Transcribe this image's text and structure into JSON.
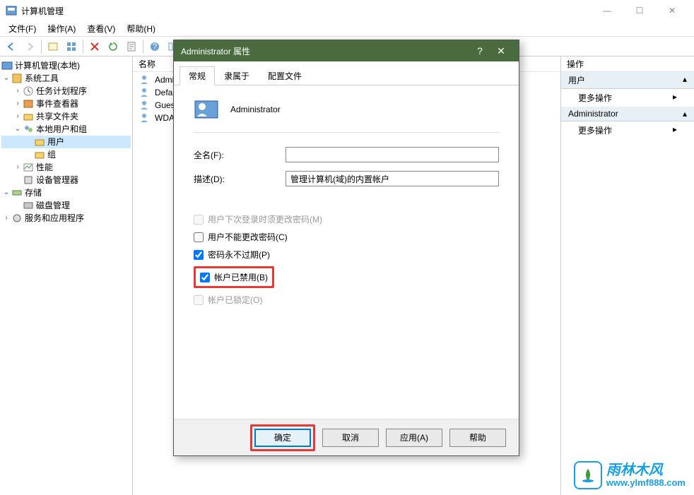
{
  "window": {
    "title": "计算机管理"
  },
  "menu": {
    "file": "文件(F)",
    "action": "操作(A)",
    "view": "查看(V)",
    "help": "帮助(H)"
  },
  "tree": {
    "root": "计算机管理(本地)",
    "system_tools": "系统工具",
    "task_scheduler": "任务计划程序",
    "event_viewer": "事件查看器",
    "shared_folders": "共享文件夹",
    "local_users": "本地用户和组",
    "users": "用户",
    "groups": "组",
    "performance": "性能",
    "device_manager": "设备管理器",
    "storage": "存储",
    "disk_mgmt": "磁盘管理",
    "services": "服务和应用程序"
  },
  "list": {
    "header": "名称",
    "items": [
      "Admi...",
      "Defa...",
      "Gues...",
      "WDA..."
    ]
  },
  "actions": {
    "header": "操作",
    "section1": "用户",
    "more1": "更多操作",
    "section2": "Administrator",
    "more2": "更多操作"
  },
  "dialog": {
    "title": "Administrator 属性",
    "tabs": {
      "general": "常规",
      "memberof": "隶属于",
      "profile": "配置文件"
    },
    "username": "Administrator",
    "fullname_label": "全名(F):",
    "fullname_value": "",
    "desc_label": "描述(D):",
    "desc_value": "管理计算机(域)的内置帐户",
    "chk_must_change": "用户下次登录时须更改密码(M)",
    "chk_cannot_change": "用户不能更改密码(C)",
    "chk_never_expire": "密码永不过期(P)",
    "chk_disabled": "帐户已禁用(B)",
    "chk_locked": "帐户已锁定(O)",
    "btn_ok": "确定",
    "btn_cancel": "取消",
    "btn_apply": "应用(A)",
    "btn_help": "帮助"
  },
  "watermark": {
    "text": "雨林木风",
    "url": "www.ylmf888.com"
  }
}
